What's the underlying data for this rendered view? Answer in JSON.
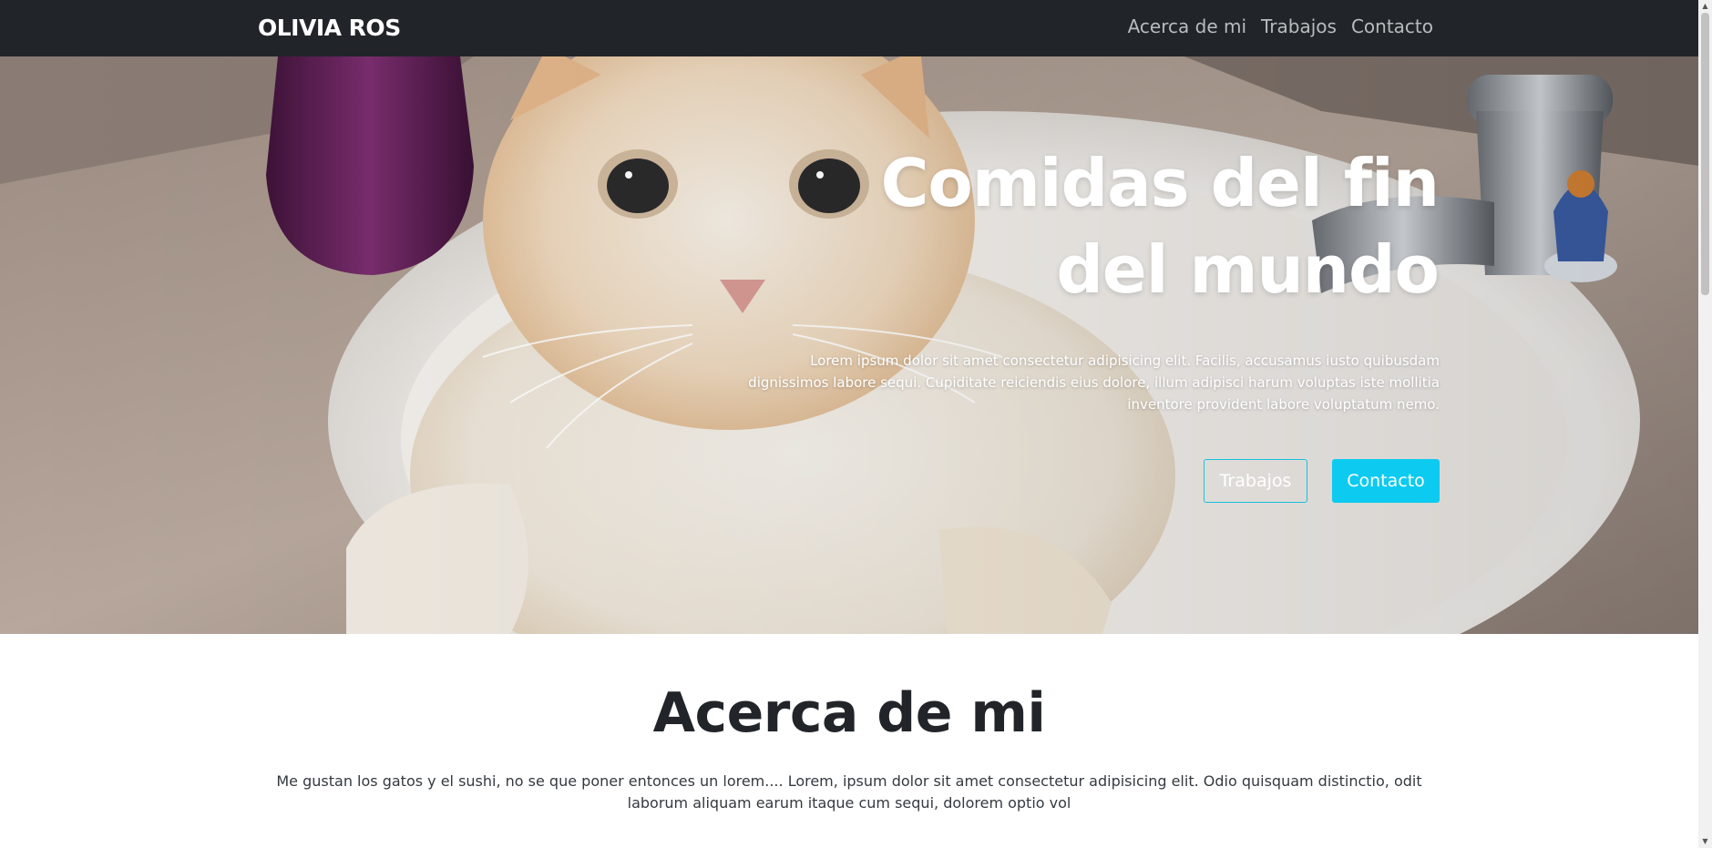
{
  "navbar": {
    "brand": "OLIVIA ROS",
    "links": [
      "Acerca de mi",
      "Trabajos",
      "Contacto"
    ]
  },
  "hero": {
    "image": "cat-in-sink-photo",
    "title": "Comidas del fin\ndel mundo",
    "text": "Lorem ipsum dolor sit amet consectetur adipisicing elit. Facilis, accusamus iusto quibusdam dignissimos labore sequi. Cupiditate reiciendis eius dolore, illum adipisci harum voluptas iste mollitia inventore provident labore voluptatum nemo.",
    "btn_outline": "Trabajos",
    "btn_primary": "Contacto"
  },
  "about": {
    "title": "Acerca de mi",
    "text": "Me gustan los gatos y el sushi, no se que poner entonces un lorem.... Lorem, ipsum dolor sit amet consectetur adipisicing elit. Odio quisquam distinctio, odit laborum aliquam earum itaque cum sequi, dolorem optio vol"
  },
  "colors": {
    "navbar_bg": "#212529",
    "accent": "#0dcaf0",
    "nav_link": "#b9bcbf"
  }
}
